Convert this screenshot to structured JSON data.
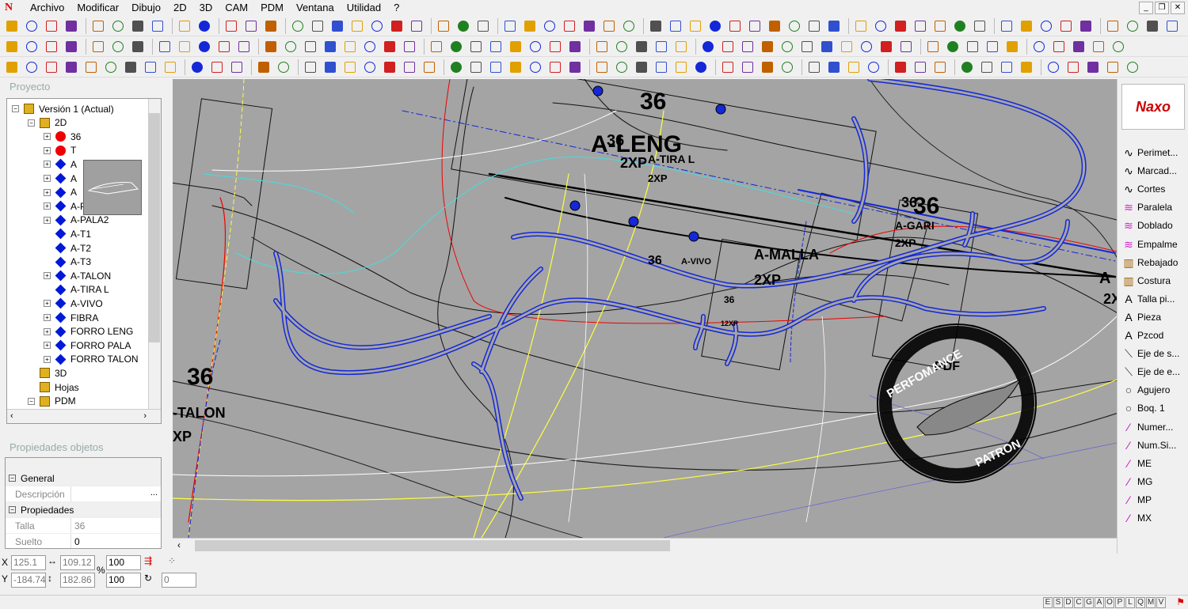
{
  "menu": {
    "items": [
      "Archivo",
      "Modificar",
      "Dibujo",
      "2D",
      "3D",
      "CAM",
      "PDM",
      "Ventana",
      "Utilidad",
      "?"
    ]
  },
  "colors": {
    "canvas_bg": "#a4a4a4",
    "pattern_blue": "#1428d8",
    "accent_red": "#e00000"
  },
  "project": {
    "title": "Proyecto",
    "tree": [
      {
        "label": "Versión 1 (Actual)",
        "icon": "version-icon",
        "level": 0
      },
      {
        "label": "2D",
        "icon": "2d-icon",
        "level": 1
      },
      {
        "label": "36",
        "icon": "red-dot",
        "level": 2
      },
      {
        "label": "T",
        "icon": "red-dot",
        "level": 2
      },
      {
        "label": "A",
        "icon": "blue-diamond",
        "level": 2
      },
      {
        "label": "A",
        "icon": "blue-diamond",
        "level": 2
      },
      {
        "label": "A",
        "icon": "blue-diamond",
        "level": 2
      },
      {
        "label": "A-PALA",
        "icon": "blue-diamond",
        "level": 2
      },
      {
        "label": "A-PALA2",
        "icon": "blue-diamond",
        "level": 2
      },
      {
        "label": "A-T1",
        "icon": "blue-diamond",
        "level": 2
      },
      {
        "label": "A-T2",
        "icon": "blue-diamond",
        "level": 2
      },
      {
        "label": "A-T3",
        "icon": "blue-diamond",
        "level": 2
      },
      {
        "label": "A-TALON",
        "icon": "blue-diamond",
        "level": 2
      },
      {
        "label": "A-TIRA L",
        "icon": "blue-diamond",
        "level": 2
      },
      {
        "label": "A-VIVO",
        "icon": "blue-diamond",
        "level": 2
      },
      {
        "label": "FIBRA",
        "icon": "blue-diamond",
        "level": 2
      },
      {
        "label": "FORRO LENG",
        "icon": "blue-diamond",
        "level": 2
      },
      {
        "label": "FORRO PALA",
        "icon": "blue-diamond",
        "level": 2
      },
      {
        "label": "FORRO TALON",
        "icon": "blue-diamond",
        "level": 2
      },
      {
        "label": "3D",
        "icon": "3d-icon",
        "level": 1
      },
      {
        "label": "Hojas",
        "icon": "sheets-icon",
        "level": 1
      },
      {
        "label": "PDM",
        "icon": "folder-icon",
        "level": 1
      }
    ]
  },
  "properties": {
    "title": "Propiedades objetos",
    "general": "General",
    "desc_label": "Descripción",
    "desc_btn": "...",
    "props_header": "Propiedades",
    "talla_label": "Talla",
    "talla_value": "36",
    "suelto_label": "Suelto",
    "suelto_value": "0"
  },
  "canvas_labels": [
    {
      "t": "36"
    },
    {
      "t": "A-LENG"
    },
    {
      "t": "36"
    },
    {
      "t": "2XP"
    },
    {
      "t": "A-TIRA L"
    },
    {
      "t": "2XP"
    },
    {
      "t": "36"
    },
    {
      "t": "36"
    },
    {
      "t": "A-GARI"
    },
    {
      "t": "2XP"
    },
    {
      "t": "36"
    },
    {
      "t": "A-VIVO"
    },
    {
      "t": "A-MALLA"
    },
    {
      "t": "2XP"
    },
    {
      "t": "36"
    },
    {
      "t": "12XP"
    },
    {
      "t": "36"
    },
    {
      "t": "-TALON"
    },
    {
      "t": "XP"
    },
    {
      "t": "A"
    },
    {
      "t": "2X"
    }
  ],
  "watermark": {
    "top": "PERFOMANCE",
    "center": "PDF",
    "bottom": "PATRON"
  },
  "right_panel": {
    "brand": "Naxo",
    "items": [
      {
        "label": "Perimet...",
        "icon": "curve-icon"
      },
      {
        "label": "Marcad...",
        "icon": "curve-icon"
      },
      {
        "label": "Cortes",
        "icon": "curve-icon"
      },
      {
        "label": "Paralela",
        "icon": "parallel-icon"
      },
      {
        "label": "Doblado",
        "icon": "parallel-icon"
      },
      {
        "label": "Empalme",
        "icon": "parallel-icon"
      },
      {
        "label": "Rebajado",
        "icon": "rebajado-icon"
      },
      {
        "label": "Costura",
        "icon": "rebajado-icon"
      },
      {
        "label": "Talla pi...",
        "icon": "text-icon"
      },
      {
        "label": "Pieza",
        "icon": "text-icon"
      },
      {
        "label": "Pzcod",
        "icon": "text-icon"
      },
      {
        "label": "Eje de s...",
        "icon": "axis-icon"
      },
      {
        "label": "Eje de e...",
        "icon": "axis-icon"
      },
      {
        "label": "Agujero",
        "icon": "circle-icon"
      },
      {
        "label": "Boq. 1",
        "icon": "circle-icon"
      },
      {
        "label": "Numer...",
        "icon": "pen-icon"
      },
      {
        "label": "Num.Si...",
        "icon": "pen-icon"
      },
      {
        "label": "ME",
        "icon": "pen-icon"
      },
      {
        "label": "MG",
        "icon": "pen-icon"
      },
      {
        "label": "MP",
        "icon": "pen-icon"
      },
      {
        "label": "MX",
        "icon": "pen-icon"
      }
    ]
  },
  "coords": {
    "x_label": "X",
    "y_label": "Y",
    "x": "125.1",
    "y": "-184.74",
    "w": "109.12",
    "h": "182.86",
    "pct1": "100",
    "pct2": "100",
    "pct_sym": "%",
    "angle": "0"
  },
  "status_letters": [
    "E",
    "S",
    "D",
    "C",
    "G",
    "A",
    "O",
    "P",
    "L",
    "Q",
    "M",
    "V"
  ]
}
